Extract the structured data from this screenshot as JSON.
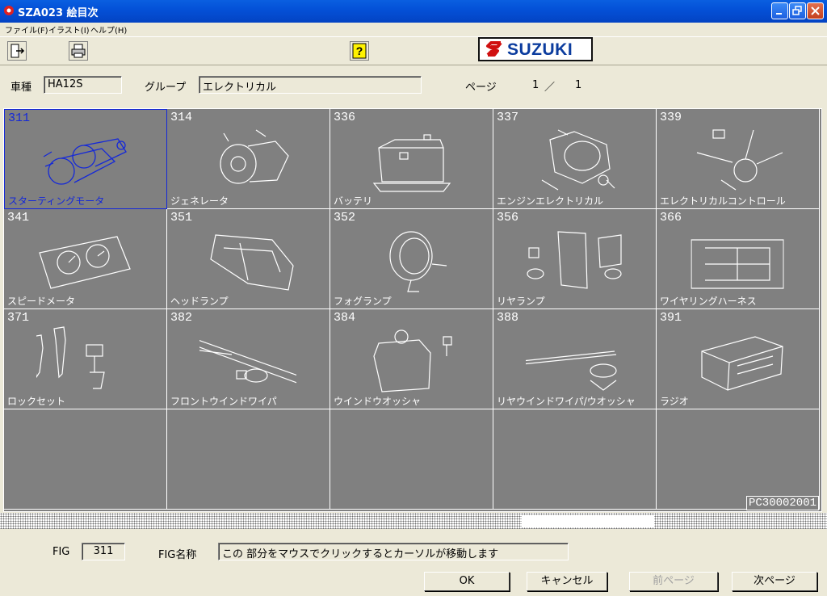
{
  "window": {
    "title": "SZA023 絵目次"
  },
  "menu": [
    "ファイル(F)",
    "イラスト(I)",
    "ヘルプ(H)"
  ],
  "logo": {
    "text": "SUZUKI"
  },
  "header": {
    "model_label": "車種",
    "model_value": "HA12S",
    "group_label": "グループ",
    "group_value": "エレクトリカル",
    "page_label": "ページ",
    "page_current": "1",
    "page_sep": "／",
    "page_total": "1"
  },
  "grid": {
    "cells": [
      {
        "num": "311",
        "name": "スターティングモータ",
        "icon": "starter-motor"
      },
      {
        "num": "314",
        "name": "ジェネレータ",
        "icon": "generator"
      },
      {
        "num": "336",
        "name": "バッテリ",
        "icon": "battery"
      },
      {
        "num": "337",
        "name": "エンジンエレクトリカル",
        "icon": "distributor"
      },
      {
        "num": "339",
        "name": "エレクトリカルコントロール",
        "icon": "combination-switch"
      },
      {
        "num": "341",
        "name": "スピードメータ",
        "icon": "speedometer"
      },
      {
        "num": "351",
        "name": "ヘッドランプ",
        "icon": "headlamp"
      },
      {
        "num": "352",
        "name": "フォグランプ",
        "icon": "fog-lamp"
      },
      {
        "num": "356",
        "name": "リヤランプ",
        "icon": "rear-lamp"
      },
      {
        "num": "366",
        "name": "ワイヤリングハーネス",
        "icon": "wiring-harness"
      },
      {
        "num": "371",
        "name": "ロックセット",
        "icon": "key-lock"
      },
      {
        "num": "382",
        "name": "フロントウインドワイパ",
        "icon": "front-wiper"
      },
      {
        "num": "384",
        "name": "ウインドウオッシャ",
        "icon": "washer-tank"
      },
      {
        "num": "388",
        "name": "リヤウインドワイパ/ウオッシャ",
        "icon": "rear-wiper"
      },
      {
        "num": "391",
        "name": "ラジオ",
        "icon": "radio"
      }
    ],
    "selected": "311",
    "code": "PC30002001"
  },
  "footer": {
    "fig_label": "FIG",
    "fig_value": "311",
    "fig_name_label": "FIG名称",
    "fig_name_value": "この 部分をマウスでクリックするとカーソルが移動します"
  },
  "buttons": {
    "ok": "OK",
    "cancel": "キャンセル",
    "prev": "前ページ",
    "next": "次ページ"
  }
}
